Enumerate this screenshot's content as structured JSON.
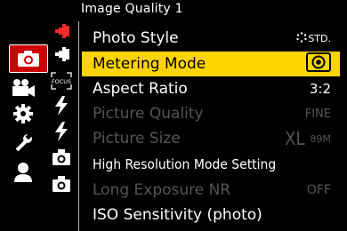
{
  "header": {
    "title": "Image Quality 1"
  },
  "colors": {
    "accent": "#ffd400",
    "active_tab": "#cc0000",
    "dim_text": "#555555"
  },
  "main_tabs": [
    {
      "name": "camera-icon",
      "active": true
    },
    {
      "name": "video-camera-icon",
      "active": false
    },
    {
      "name": "gear-icon",
      "active": false
    },
    {
      "name": "wrench-icon",
      "active": false
    },
    {
      "name": "user-icon",
      "active": false
    }
  ],
  "sub_tabs": [
    {
      "name": "image-quality-icon",
      "active": true
    },
    {
      "name": "image-quality-2-icon",
      "active": false
    },
    {
      "name": "focus-icon",
      "label": "FOCUS",
      "active": false
    },
    {
      "name": "flash-icon",
      "active": false
    },
    {
      "name": "flash-2-icon",
      "active": false
    },
    {
      "name": "camera-settings-icon",
      "active": false
    },
    {
      "name": "camera-settings-2-icon",
      "active": false
    }
  ],
  "menu": {
    "items": [
      {
        "label": "Photo Style",
        "value": "STD.",
        "value_icon": "photo-style-icon",
        "state": "normal"
      },
      {
        "label": "Metering Mode",
        "value": "",
        "value_icon": "multi-metering-icon",
        "state": "selected"
      },
      {
        "label": "Aspect Ratio",
        "value": "3:2",
        "state": "normal"
      },
      {
        "label": "Picture Quality",
        "value": "FINE",
        "state": "disabled"
      },
      {
        "label": "Picture Size",
        "value": "XL",
        "value_sub": "89M",
        "state": "disabled"
      },
      {
        "label": "High Resolution Mode Setting",
        "value": "",
        "state": "normal"
      },
      {
        "label": "Long Exposure NR",
        "value": "OFF",
        "state": "disabled"
      },
      {
        "label": "ISO Sensitivity (photo)",
        "value": "",
        "state": "normal"
      }
    ]
  }
}
